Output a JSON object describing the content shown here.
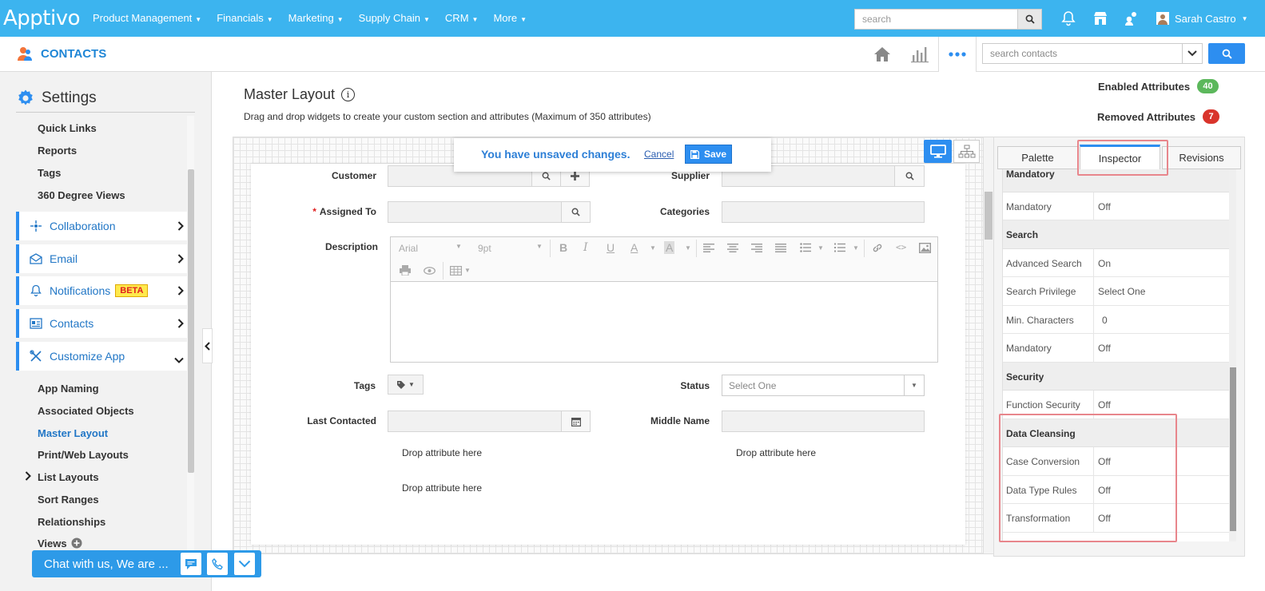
{
  "topbar": {
    "logo": "Apptivo",
    "nav": [
      {
        "label": "Product Management"
      },
      {
        "label": "Financials"
      },
      {
        "label": "Marketing"
      },
      {
        "label": "Supply Chain"
      },
      {
        "label": "CRM"
      },
      {
        "label": "More"
      }
    ],
    "search_placeholder": "search",
    "user_name": "Sarah Castro",
    "accent": "#3cb4ef"
  },
  "subbar": {
    "app_name": "CONTACTS",
    "search_placeholder": "search contacts"
  },
  "sidebar": {
    "title": "Settings",
    "top_links": [
      "Quick Links",
      "Reports",
      "Tags",
      "360 Degree Views"
    ],
    "groups": [
      {
        "label": "Collaboration",
        "icon": "collaboration-icon"
      },
      {
        "label": "Email",
        "icon": "email-icon"
      },
      {
        "label": "Notifications",
        "icon": "bell-icon",
        "badge": "BETA"
      },
      {
        "label": "Contacts",
        "icon": "contacts-icon"
      },
      {
        "label": "Customize App",
        "icon": "tools-icon"
      }
    ],
    "sub_links": [
      "App Naming",
      "Associated Objects",
      "Master Layout",
      "Print/Web Layouts",
      "List Layouts",
      "Sort Ranges",
      "Relationships",
      "Views"
    ]
  },
  "main": {
    "title": "Master Layout",
    "description": "Drag and drop widgets to create your custom section and attributes (Maximum of 350 attributes)",
    "enabled_label": "Enabled Attributes",
    "enabled_count": "40",
    "removed_label": "Removed Attributes",
    "removed_count": "7",
    "unsaved_text": "You have unsaved changes.",
    "cancel_label": "Cancel",
    "save_label": "Save"
  },
  "form": {
    "customer": "Customer",
    "supplier": "Supplier",
    "assigned_to": "Assigned To",
    "categories": "Categories",
    "description": "Description",
    "font_name": "Arial",
    "font_size": "9pt",
    "tags": "Tags",
    "status": "Status",
    "status_value": "Select One",
    "last_contacted": "Last Contacted",
    "middle_name": "Middle Name",
    "drop_here": "Drop attribute here"
  },
  "inspector": {
    "tabs": [
      "Palette",
      "Inspector",
      "Revisions"
    ],
    "rows": [
      {
        "type": "section",
        "label": "Mandatory"
      },
      {
        "type": "row",
        "label": "Mandatory",
        "value": "Off"
      },
      {
        "type": "section",
        "label": "Search"
      },
      {
        "type": "row",
        "label": "Advanced Search",
        "value": "On"
      },
      {
        "type": "row",
        "label": "Search Privilege",
        "value": "Select One"
      },
      {
        "type": "row",
        "label": "Min. Characters",
        "value": "0"
      },
      {
        "type": "row",
        "label": "Mandatory",
        "value": "Off"
      },
      {
        "type": "section",
        "label": "Security"
      },
      {
        "type": "row",
        "label": "Function Security",
        "value": "Off"
      },
      {
        "type": "section",
        "label": "Data Cleansing"
      },
      {
        "type": "row",
        "label": "Case Conversion",
        "value": "Off"
      },
      {
        "type": "row",
        "label": "Data Type Rules",
        "value": "Off"
      },
      {
        "type": "row",
        "label": "Transformation",
        "value": "Off"
      }
    ]
  },
  "chat": {
    "text": "Chat with us, We are ..."
  }
}
